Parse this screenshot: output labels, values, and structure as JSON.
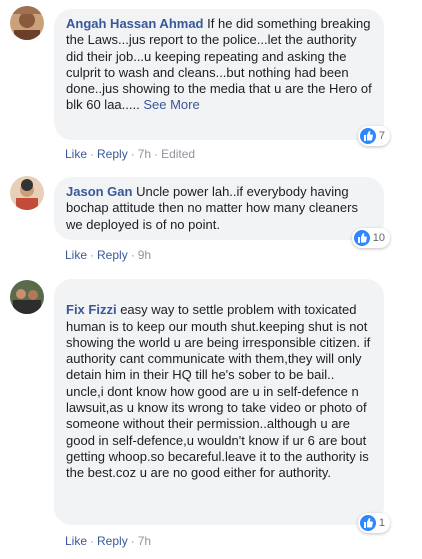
{
  "comments": [
    {
      "author": "Angah Hassan Ahmad",
      "text": "If he did something breaking the Laws...jus report to the police...let the authority did their job...u keeping repeating and asking the culprit to wash and cleans...but nothing had been done..jus showing to the media that u are the Hero of blk 60 laa.....",
      "see_more": "See More",
      "likes": "7",
      "like_label": "Like",
      "reply_label": "Reply",
      "time": "7h",
      "edited": "Edited"
    },
    {
      "author": "Jason Gan",
      "text": "Uncle power lah..if everybody having bochap attitude then no matter how many cleaners we deployed is of no point.",
      "likes": "10",
      "like_label": "Like",
      "reply_label": "Reply",
      "time": "9h"
    },
    {
      "author": "Fix Fizzi",
      "text": "easy way to settle problem with toxicated human is to keep our mouth shut.keeping shut is not showing the world u are being irresponsible citizen.\nif authority cant communicate with them,they will only detain him in their HQ till he's sober to be bail..\nuncle,i dont know how good are u in self-defence n lawsuit,as u know its wrong to take video or photo of someone without their permission..although u are good in self-defence,u wouldn't know if ur 6 are bout getting whoop.so becareful.leave it to the authority is the best.coz u are no good either for authority.",
      "likes": "1",
      "like_label": "Like",
      "reply_label": "Reply",
      "time": "7h"
    }
  ],
  "colors": {
    "link": "#385898",
    "bubble": "#f2f3f5",
    "meta": "#90949c",
    "like_blue": "#2d88ff"
  },
  "icons": [
    "avatar",
    "like-thumb-icon"
  ]
}
